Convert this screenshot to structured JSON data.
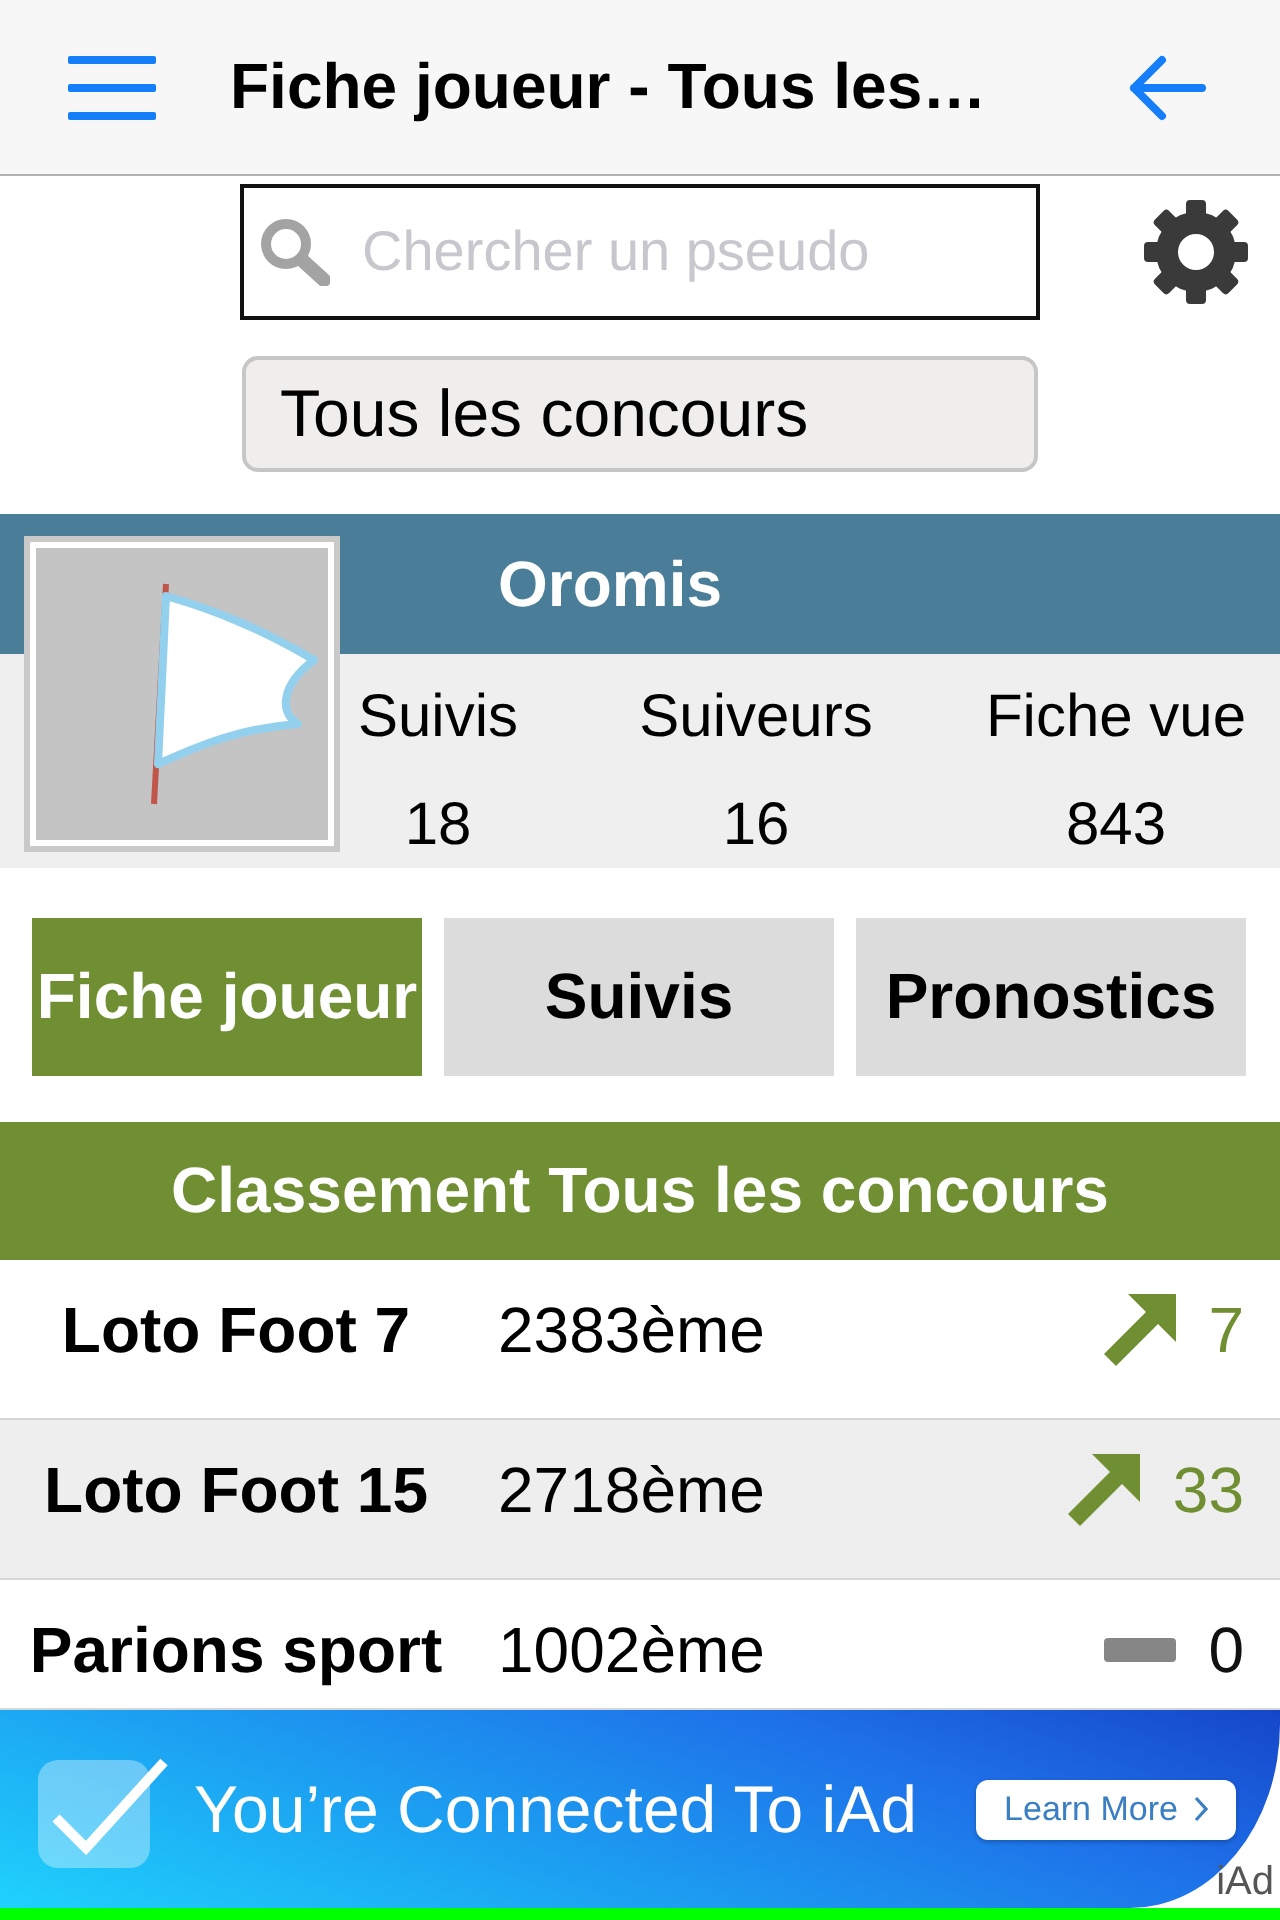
{
  "nav_bar": {
    "title": "Fiche joueur - Tous les…"
  },
  "search": {
    "placeholder": "Chercher un pseudo"
  },
  "competition_filter": {
    "value": "Tous les concours"
  },
  "profile": {
    "username": "Oromis",
    "stats": [
      {
        "label": "Suivis",
        "value": "18"
      },
      {
        "label": "Suiveurs",
        "value": "16"
      },
      {
        "label": "Fiche vue",
        "value": "843"
      }
    ]
  },
  "tabs": [
    {
      "label": "Fiche joueur",
      "selected": true
    },
    {
      "label": "Suivis",
      "selected": false
    },
    {
      "label": "Pronostics",
      "selected": false
    }
  ],
  "ranking": {
    "title": "Classement Tous les concours",
    "rows": [
      {
        "kind": "up",
        "competition": "Loto Foot 7",
        "rank": "2383ème",
        "change": "7"
      },
      {
        "kind": "up",
        "competition": "Loto Foot 15",
        "rank": "2718ème",
        "change": "33"
      },
      {
        "kind": "flat",
        "competition": "Parions sport",
        "rank": "1002ème",
        "change": "0"
      }
    ]
  },
  "ad_banner": {
    "headline": "You’re Connected To iAd",
    "button": "Learn More",
    "badge": "iAd"
  }
}
